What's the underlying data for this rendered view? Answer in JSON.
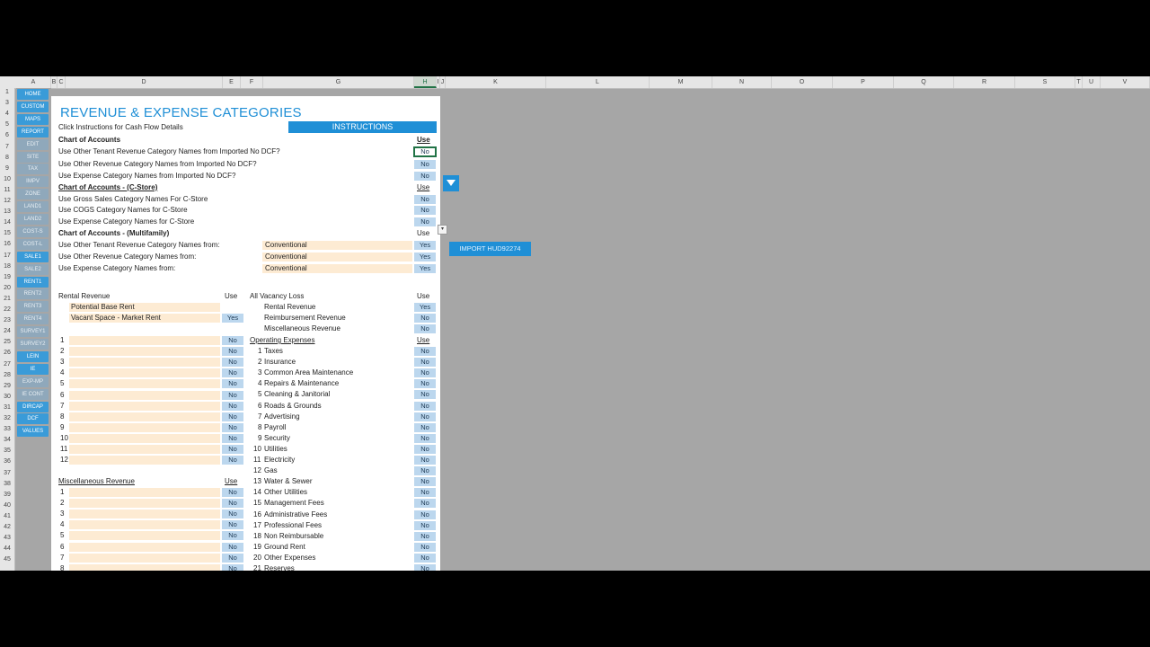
{
  "columns": [
    "A",
    "B",
    "C",
    "D",
    "E",
    "F",
    "G",
    "H",
    "I",
    "J",
    "K",
    "L",
    "M",
    "N",
    "O",
    "P",
    "Q",
    "R",
    "S",
    "T",
    "U",
    "V"
  ],
  "rows": [
    "1",
    "3",
    "4",
    "5",
    "6",
    "7",
    "8",
    "9",
    "10",
    "11",
    "12",
    "13",
    "14",
    "15",
    "16",
    "17",
    "18",
    "19",
    "20",
    "21",
    "22",
    "23",
    "24",
    "25",
    "26",
    "27",
    "28",
    "29",
    "30",
    "31",
    "32",
    "33",
    "34",
    "35",
    "36",
    "37",
    "38",
    "39",
    "40",
    "41",
    "42",
    "43",
    "44",
    "45"
  ],
  "nav": [
    "HOME",
    "CUSTOM",
    "MAPS",
    "REPORT",
    "EDIT",
    "SITE",
    "TAX",
    "IMPV",
    "ZONE",
    "LAND1",
    "LAND2",
    "COST-S",
    "COST-L",
    "SALE1",
    "SALE2",
    "RENT1",
    "RENT2",
    "RENT3",
    "RENT4",
    "SURVEY1",
    "SURVEY2",
    "LEIN",
    "IE",
    "EXP-MP",
    "IE CONT",
    "DIRCAP",
    "DCF",
    "VALUES"
  ],
  "title": "REVENUE & EXPENSE CATEGORIES",
  "instructions_button": "INSTRUCTIONS",
  "import_button": "IMPORT HUD92274",
  "click_instructions": "Click Instructions for Cash Flow Details",
  "use_header": "Use",
  "coa": {
    "heading": "Chart of Accounts",
    "items": [
      {
        "label": "Use Other Tenant Revenue Category Names from Imported No DCF?",
        "value": "No"
      },
      {
        "label": "Use Other Revenue Category Names from Imported No DCF?",
        "value": "No"
      },
      {
        "label": "Use Expense Category Names from Imported No DCF?",
        "value": "No"
      }
    ]
  },
  "cstore": {
    "heading": "Chart of Accounts - (C-Store)",
    "items": [
      {
        "label": "Use Gross Sales Category Names For C-Store",
        "value": "No"
      },
      {
        "label": "Use COGS Category Names for C-Store",
        "value": "No"
      },
      {
        "label": "Use Expense Category Names for C-Store",
        "value": "No"
      }
    ]
  },
  "multifamily": {
    "heading": "Chart of Accounts - (Multifamily)",
    "items": [
      {
        "label": "Use Other Tenant Revenue Category Names from:",
        "source": "Conventional",
        "value": "Yes"
      },
      {
        "label": "Use Other Revenue Category Names from:",
        "source": "Conventional",
        "value": "Yes"
      },
      {
        "label": "Use Expense Category Names from:",
        "source": "Conventional",
        "value": "Yes"
      }
    ]
  },
  "rental": {
    "heading": "Rental Revenue",
    "use": "Use",
    "items": [
      {
        "label": "Potential Base Rent",
        "value": ""
      },
      {
        "label": "Vacant Space - Market Rent",
        "value": "Yes"
      }
    ],
    "numbered": [
      {
        "n": "1",
        "value": "No"
      },
      {
        "n": "2",
        "value": "No"
      },
      {
        "n": "3",
        "value": "No"
      },
      {
        "n": "4",
        "value": "No"
      },
      {
        "n": "5",
        "value": "No"
      },
      {
        "n": "6",
        "value": "No"
      },
      {
        "n": "7",
        "value": "No"
      },
      {
        "n": "8",
        "value": "No"
      },
      {
        "n": "9",
        "value": "No"
      },
      {
        "n": "10",
        "value": "No"
      },
      {
        "n": "11",
        "value": "No"
      },
      {
        "n": "12",
        "value": "No"
      }
    ]
  },
  "misc": {
    "heading": "Miscellaneous Revenue",
    "use": "Use",
    "numbered": [
      {
        "n": "1",
        "value": "No"
      },
      {
        "n": "2",
        "value": "No"
      },
      {
        "n": "3",
        "value": "No"
      },
      {
        "n": "4",
        "value": "No"
      },
      {
        "n": "5",
        "value": "No"
      },
      {
        "n": "6",
        "value": "No"
      },
      {
        "n": "7",
        "value": "No"
      },
      {
        "n": "8",
        "value": "No"
      }
    ]
  },
  "vacancy": {
    "heading": "All Vacancy Loss",
    "use": "Use",
    "items": [
      {
        "label": "Rental Revenue",
        "value": "Yes"
      },
      {
        "label": "Reimbursement Revenue",
        "value": "No"
      },
      {
        "label": "Miscellaneous Revenue",
        "value": "No"
      }
    ]
  },
  "opex": {
    "heading": "Operating Expenses",
    "use": "Use",
    "items": [
      {
        "n": "1",
        "label": "Taxes",
        "value": "No"
      },
      {
        "n": "2",
        "label": "Insurance",
        "value": "No"
      },
      {
        "n": "3",
        "label": "Common Area Maintenance",
        "value": "No"
      },
      {
        "n": "4",
        "label": "Repairs & Maintenance",
        "value": "No"
      },
      {
        "n": "5",
        "label": "Cleaning & Janitorial",
        "value": "No"
      },
      {
        "n": "6",
        "label": "Roads & Grounds",
        "value": "No"
      },
      {
        "n": "7",
        "label": "Advertising",
        "value": "No"
      },
      {
        "n": "8",
        "label": "Payroll",
        "value": "No"
      },
      {
        "n": "9",
        "label": "Security",
        "value": "No"
      },
      {
        "n": "10",
        "label": "Utilities",
        "value": "No"
      },
      {
        "n": "11",
        "label": "Electricity",
        "value": "No"
      },
      {
        "n": "12",
        "label": "Gas",
        "value": "No"
      },
      {
        "n": "13",
        "label": "Water & Sewer",
        "value": "No"
      },
      {
        "n": "14",
        "label": "Other Utilities",
        "value": "No"
      },
      {
        "n": "15",
        "label": "Management Fees",
        "value": "No"
      },
      {
        "n": "16",
        "label": "Administrative Fees",
        "value": "No"
      },
      {
        "n": "17",
        "label": "Professional Fees",
        "value": "No"
      },
      {
        "n": "18",
        "label": "Non Reimbursable",
        "value": "No"
      },
      {
        "n": "19",
        "label": "Ground Rent",
        "value": "No"
      },
      {
        "n": "20",
        "label": "Other Expenses",
        "value": "No"
      },
      {
        "n": "21",
        "label": "Reserves",
        "value": "No"
      }
    ]
  }
}
